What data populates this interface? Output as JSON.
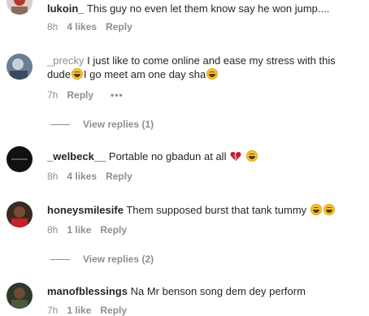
{
  "comments": [
    {
      "username": "lukoin_",
      "text": "This guy no even let them know say he won jump....",
      "time": "8h",
      "likes": "4 likes",
      "reply": "Reply"
    },
    {
      "username": "_precky",
      "text_part1": "I just like to come online and ease my stress with this dude",
      "text_part2": "I go meet am one day sha",
      "time": "7h",
      "reply": "Reply",
      "more": "•••",
      "view_replies": "View replies (1)"
    },
    {
      "username": "_welbeck__",
      "text": "Portable no gbadun at all",
      "time": "8h",
      "likes": "4 likes",
      "reply": "Reply"
    },
    {
      "username": "honeysmilesife",
      "text": "Them supposed burst that tank tummy",
      "time": "8h",
      "likes": "1 like",
      "reply": "Reply",
      "view_replies": "View replies (2)"
    },
    {
      "username": "manofblessings",
      "text": "Na Mr benson song dem dey perform",
      "time": "7h",
      "likes": "1 like",
      "reply": "Reply"
    }
  ],
  "colors": {
    "text": "#262626",
    "secondary": "#8e8e8e",
    "heart": "#c2202e",
    "emoji": "#f7c531"
  }
}
